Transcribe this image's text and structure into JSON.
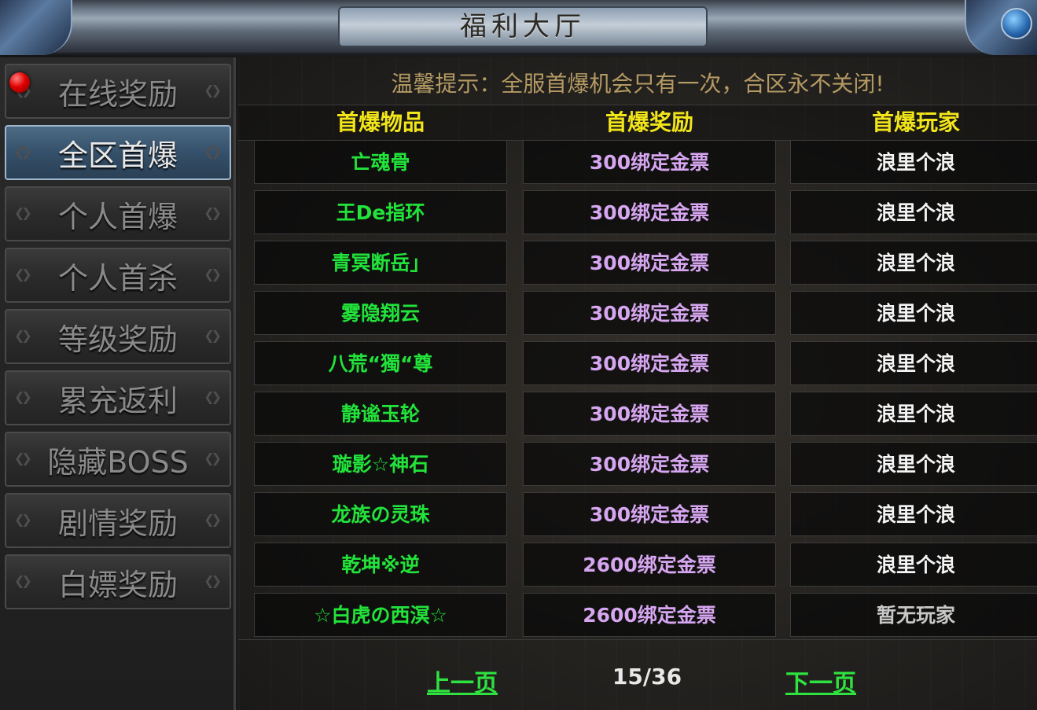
{
  "window": {
    "title": "福利大厅"
  },
  "sidebar": {
    "items": [
      {
        "label": "在线奖励",
        "active": false,
        "badge": true
      },
      {
        "label": "全区首爆",
        "active": true,
        "badge": false
      },
      {
        "label": "个人首爆",
        "active": false,
        "badge": false
      },
      {
        "label": "个人首杀",
        "active": false,
        "badge": false
      },
      {
        "label": "等级奖励",
        "active": false,
        "badge": false
      },
      {
        "label": "累充返利",
        "active": false,
        "badge": false
      },
      {
        "label": "隐藏BOSS",
        "active": false,
        "badge": false
      },
      {
        "label": "剧情奖励",
        "active": false,
        "badge": false
      },
      {
        "label": "白嫖奖励",
        "active": false,
        "badge": false
      }
    ]
  },
  "main": {
    "tip": "温馨提示：全服首爆机会只有一次，合区永不关闭!",
    "columns": [
      "首爆物品",
      "首爆奖励",
      "首爆玩家"
    ],
    "rows": [
      {
        "item": "亡魂骨",
        "reward": "300绑定金票",
        "player": "浪里个浪"
      },
      {
        "item": "王De指环",
        "reward": "300绑定金票",
        "player": "浪里个浪"
      },
      {
        "item": "青冥断岳」",
        "reward": "300绑定金票",
        "player": "浪里个浪"
      },
      {
        "item": "雾隐翔云",
        "reward": "300绑定金票",
        "player": "浪里个浪"
      },
      {
        "item": "八荒“獨“尊",
        "reward": "300绑定金票",
        "player": "浪里个浪"
      },
      {
        "item": "静谧玉轮",
        "reward": "300绑定金票",
        "player": "浪里个浪"
      },
      {
        "item": "璇影☆神石",
        "reward": "300绑定金票",
        "player": "浪里个浪"
      },
      {
        "item": "龙族の灵珠",
        "reward": "300绑定金票",
        "player": "浪里个浪"
      },
      {
        "item": "乾坤※逆",
        "reward": "2600绑定金票",
        "player": "浪里个浪"
      },
      {
        "item": "☆白虎の西溟☆",
        "reward": "2600绑定金票",
        "player": "暂无玩家"
      }
    ]
  },
  "pager": {
    "prev_label": "上一页",
    "next_label": "下一页",
    "indicator": "15/36"
  },
  "colors": {
    "item_green": "#22e33a",
    "reward_purple": "#d6a6f0",
    "header_yellow": "#f2e51a",
    "tip_gold": "#b49a63",
    "badge_red": "#e00000"
  }
}
